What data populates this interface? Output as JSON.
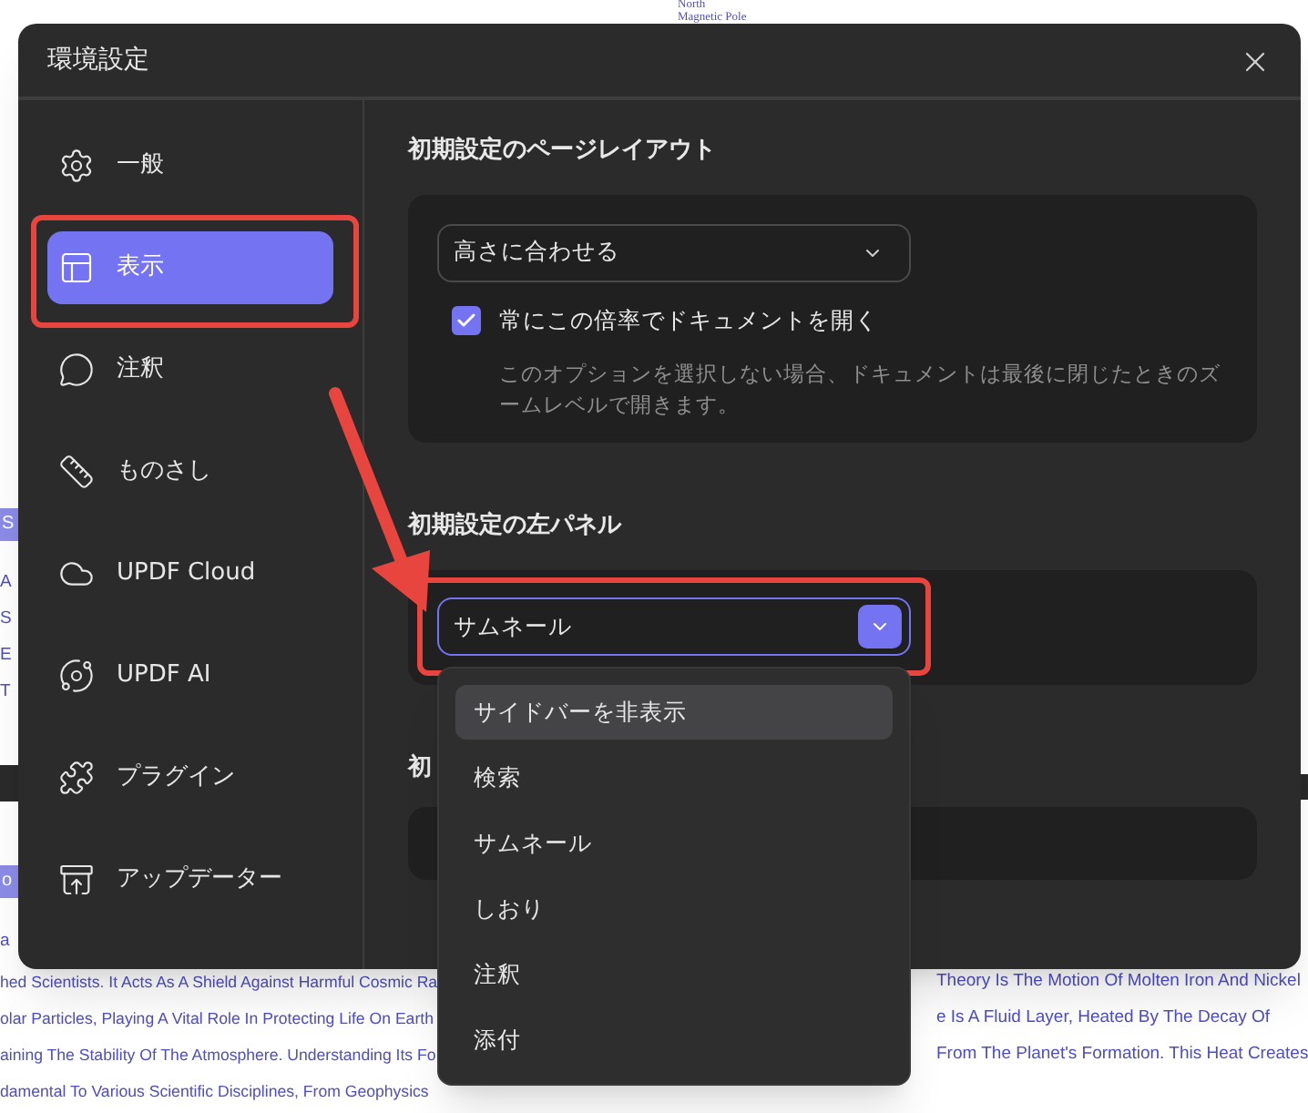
{
  "background_page": {
    "labels": [
      "North",
      "Magnetic Pole"
    ],
    "left_fragments": [
      {
        "kind": "badge",
        "text": "S"
      },
      {
        "kind": "text",
        "text": "A"
      },
      {
        "kind": "text",
        "text": "S"
      },
      {
        "kind": "text",
        "text": "E"
      },
      {
        "kind": "text",
        "text": "T"
      },
      {
        "kind": "badge",
        "text": "o"
      },
      {
        "kind": "text",
        "text": "a"
      }
    ],
    "bottom_left_lines": [
      "hed Scientists. It Acts As A Shield Against Harmful Cosmic Ra",
      "olar Particles, Playing A Vital Role In Protecting Life On Earth",
      "aining The Stability Of The Atmosphere. Understanding Its Fo",
      "damental To Various Scientific Disciplines, From Geophysics"
    ],
    "bottom_right_lines": [
      "Theory Is The Motion Of Molten Iron And Nickel",
      "e Is A Fluid Layer, Heated By The Decay Of",
      "From The Planet's Formation. This Heat Creates"
    ]
  },
  "window": {
    "title": "環境設定"
  },
  "sidebar": {
    "items": [
      {
        "kind": "gear",
        "label": "一般",
        "selected": false
      },
      {
        "kind": "layout",
        "label": "表示",
        "selected": true
      },
      {
        "kind": "comment",
        "label": "注釈",
        "selected": false
      },
      {
        "kind": "ruler",
        "label": "ものさし",
        "selected": false
      },
      {
        "kind": "cloud",
        "label": "UPDF Cloud",
        "selected": false
      },
      {
        "kind": "ai",
        "label": "UPDF AI",
        "selected": false
      },
      {
        "kind": "plugin",
        "label": "プラグイン",
        "selected": false
      },
      {
        "kind": "update",
        "label": "アップデーター",
        "selected": false
      }
    ]
  },
  "sections": [
    {
      "title": "初期設定のページレイアウト",
      "select": {
        "value": "高さに合わせる",
        "open": false
      },
      "checkbox": {
        "label": "常にこの倍率でドキュメントを開く",
        "checked": true
      },
      "description": "このオプションを選択しない場合、ドキュメントは最後に閉じたときのズームレベルで開きます。"
    },
    {
      "title": "初期設定の左パネル",
      "select": {
        "value": "サムネール",
        "open": true,
        "options": [
          {
            "label": "サイドバーを非表示",
            "highlighted": true
          },
          {
            "label": "検索",
            "highlighted": false
          },
          {
            "label": "サムネール",
            "highlighted": false
          },
          {
            "label": "しおり",
            "highlighted": false
          },
          {
            "label": "注釈",
            "highlighted": false
          },
          {
            "label": "添付",
            "highlighted": false
          }
        ]
      }
    },
    {
      "title": "初"
    }
  ]
}
